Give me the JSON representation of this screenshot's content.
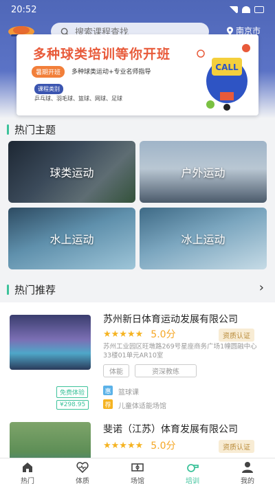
{
  "status": {
    "time": "20:52"
  },
  "header": {
    "search_placeholder": "搜索课程查找",
    "location": "南京市"
  },
  "banner": {
    "title": "多种球类培训等你开班",
    "tag": "暑期开班",
    "subtitle": "多种球类运动+专业名师指导",
    "tag2": "课程类别",
    "items": "乒乓球、羽毛球、篮球、网球、足球"
  },
  "hot_topics": {
    "heading": "热门主题",
    "tiles": [
      {
        "label": "球类运动"
      },
      {
        "label": "户外运动"
      },
      {
        "label": "水上运动"
      },
      {
        "label": "冰上运动"
      }
    ]
  },
  "hot_recommend": {
    "heading": "热门推荐",
    "items": [
      {
        "title": "苏州新日体育运动发展有限公司",
        "rating": "5.0分",
        "cert": "资质认证",
        "address": "苏州工业园区旺墩路269号星座商务广场1幢圆融中心33楼01单元AR10室",
        "tags": [
          "体能",
          "资深教练"
        ],
        "promo1_label": "免费体验",
        "promo1_text": "篮球课",
        "promo2_label": "¥298.95",
        "promo2_text": "儿童体适能场馆"
      },
      {
        "title": "斐诺（江苏）体育发展有限公司",
        "rating": "5.0分",
        "cert": "资质认证"
      }
    ]
  },
  "tabbar": {
    "items": [
      {
        "label": "热门"
      },
      {
        "label": "体质"
      },
      {
        "label": "场馆"
      },
      {
        "label": "培训"
      },
      {
        "label": "我的"
      }
    ],
    "active_index": 3
  },
  "colors": {
    "accent": "#3cc29a",
    "header_blue": "#4f67b8",
    "star": "#f5b321"
  }
}
